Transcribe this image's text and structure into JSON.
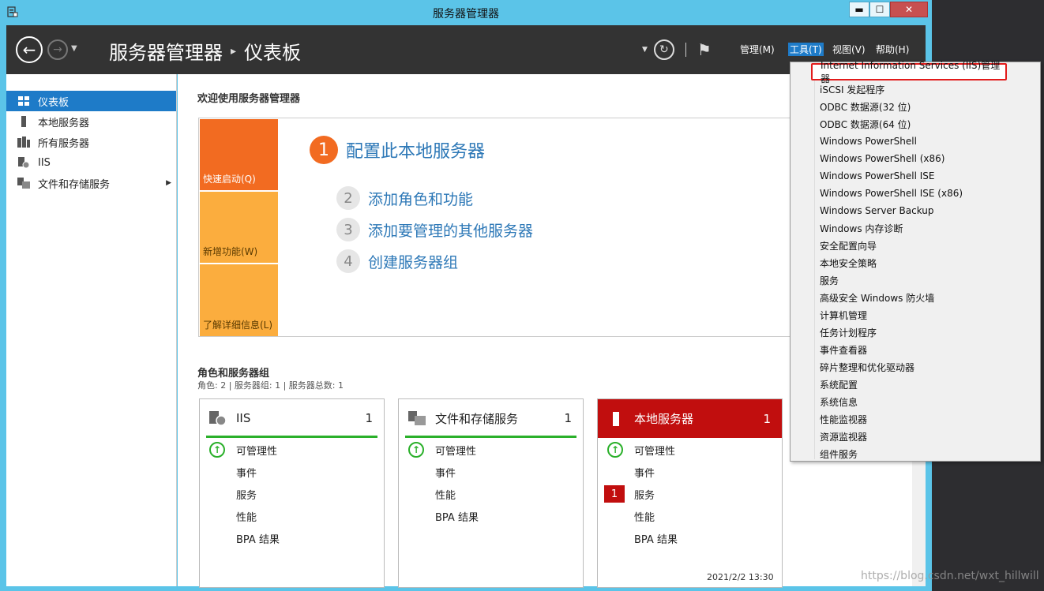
{
  "window": {
    "title": "服务器管理器",
    "min_label": "▬",
    "max_label": "☐",
    "close_label": "✕"
  },
  "navbar": {
    "breadcrumb_root": "服务器管理器",
    "breadcrumb_sep": "▸",
    "breadcrumb_page": "仪表板",
    "menus": {
      "manage": "管理(M)",
      "tools": "工具(T)",
      "view": "视图(V)",
      "help": "帮助(H)"
    }
  },
  "sidebar": {
    "items": [
      {
        "label": "仪表板",
        "icon": "dashboard-icon"
      },
      {
        "label": "本地服务器",
        "icon": "local-server-icon"
      },
      {
        "label": "所有服务器",
        "icon": "all-servers-icon"
      },
      {
        "label": "IIS",
        "icon": "iis-icon"
      },
      {
        "label": "文件和存储服务",
        "icon": "file-storage-icon"
      }
    ]
  },
  "main": {
    "welcome": "欢迎使用服务器管理器",
    "tiles": {
      "quick_start": "快速启动(Q)",
      "whats_new": "新增功能(W)",
      "learn_more": "了解详细信息(L)"
    },
    "steps": [
      {
        "num": "1",
        "label": "配置此本地服务器"
      },
      {
        "num": "2",
        "label": "添加角色和功能"
      },
      {
        "num": "3",
        "label": "添加要管理的其他服务器"
      },
      {
        "num": "4",
        "label": "创建服务器组"
      }
    ],
    "roles_title": "角色和服务器组",
    "roles_sub": "角色: 2 | 服务器组: 1 | 服务器总数: 1",
    "cards": [
      {
        "title": "IIS",
        "count": "1",
        "rows": [
          "可管理性",
          "事件",
          "服务",
          "性能",
          "BPA 结果"
        ]
      },
      {
        "title": "文件和存储服务",
        "count": "1",
        "rows": [
          "可管理性",
          "事件",
          "性能",
          "BPA 结果"
        ]
      },
      {
        "title": "本地服务器",
        "count": "1",
        "rows": [
          "可管理性",
          "事件",
          "服务",
          "性能",
          "BPA 结果"
        ],
        "service_badge": "1"
      }
    ],
    "timestamp": "2021/2/2 13:30"
  },
  "tools_menu": {
    "items": [
      "Internet Information Services (IIS)管理器",
      "iSCSI 发起程序",
      "ODBC 数据源(32 位)",
      "ODBC 数据源(64 位)",
      "Windows PowerShell",
      "Windows PowerShell (x86)",
      "Windows PowerShell ISE",
      "Windows PowerShell ISE (x86)",
      "Windows Server Backup",
      "Windows 内存诊断",
      "安全配置向导",
      "本地安全策略",
      "服务",
      "高级安全 Windows 防火墙",
      "计算机管理",
      "任务计划程序",
      "事件查看器",
      "碎片整理和优化驱动器",
      "系统配置",
      "系统信息",
      "性能监视器",
      "资源监视器",
      "组件服务"
    ]
  },
  "watermark": "https://blog.csdn.net/wxt_hillwill"
}
